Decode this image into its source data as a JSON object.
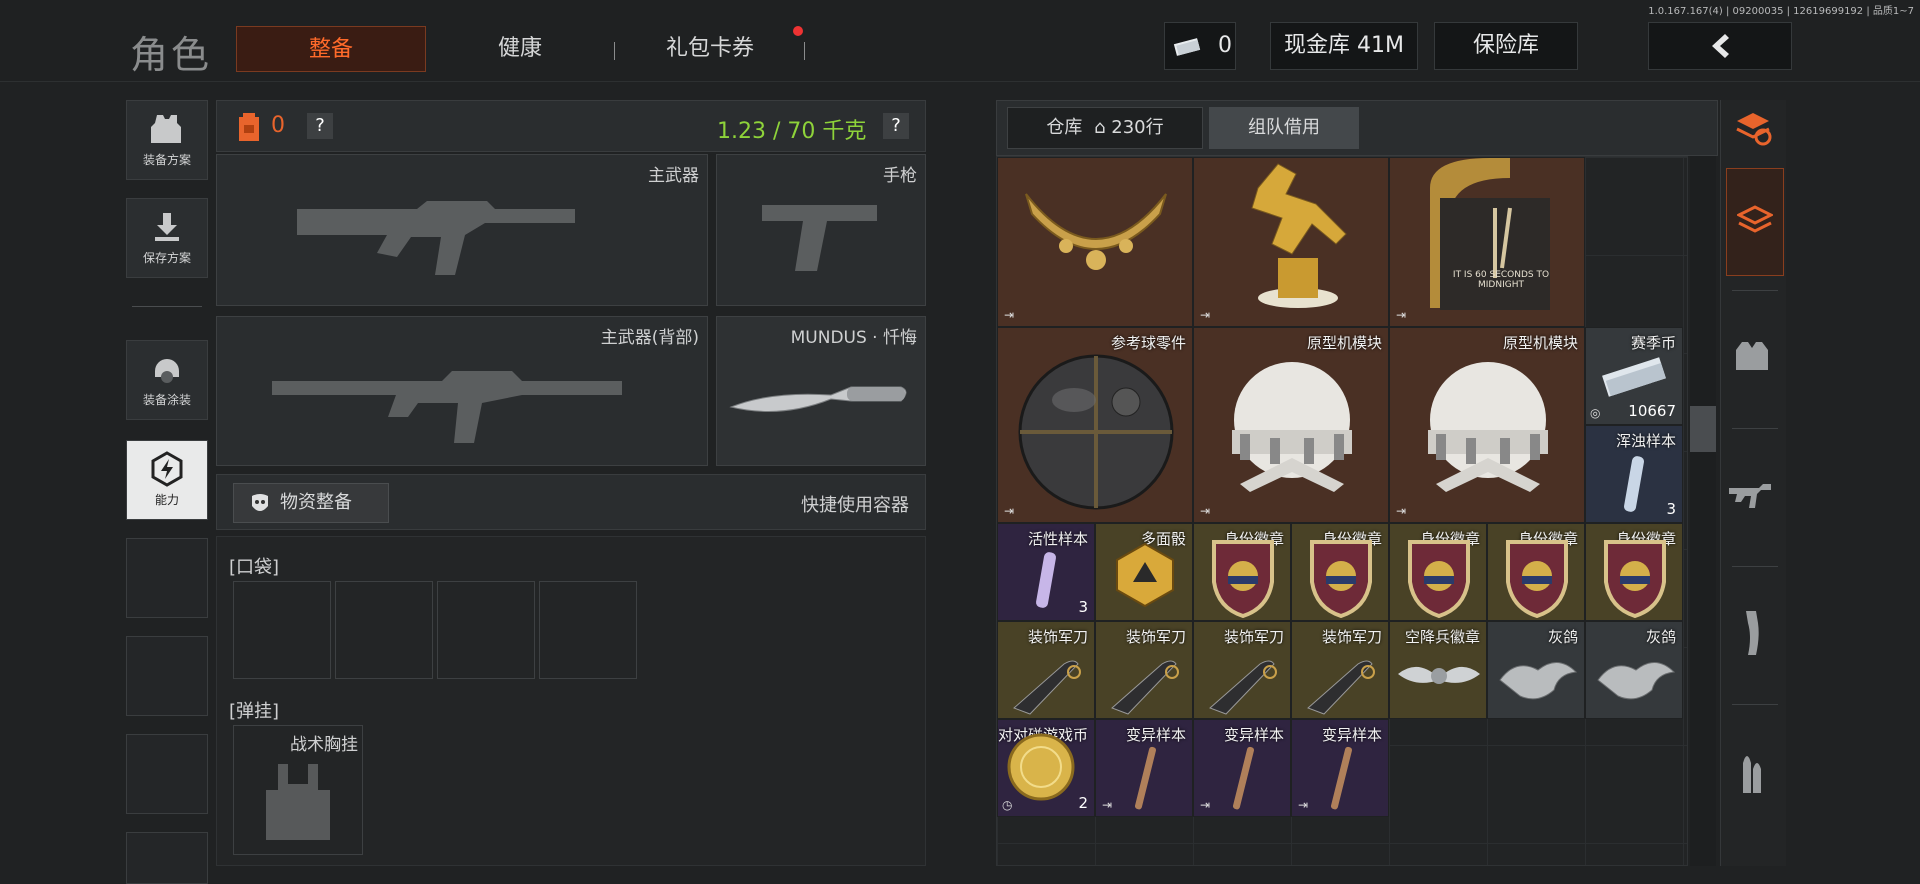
{
  "version": "1.0.167.167(4) | 09200035 | 12619699192 | 品质1~7",
  "header": {
    "title": "角色",
    "tabs": [
      {
        "label": "整备",
        "active": true
      },
      {
        "label": "健康",
        "active": false
      },
      {
        "label": "礼包卡券",
        "active": false
      }
    ],
    "cash_value": "0",
    "cash_vault": "现金库 41M",
    "safe_box": "保险库"
  },
  "left_nav": [
    {
      "label": "装备方案",
      "icon": "vest-icon"
    },
    {
      "label": "保存方案",
      "icon": "download-icon"
    },
    {
      "label": "装备涂装",
      "icon": "helmet-paint-icon"
    },
    {
      "label": "能力",
      "icon": "ability-icon",
      "selected": true
    }
  ],
  "loadout": {
    "bag_count": "0",
    "help": "?",
    "weight": "1.23 / 70 千克",
    "slots": {
      "primary": "主武器",
      "pistol": "手枪",
      "primary_back": "主武器(背部)",
      "melee": "MUNDUS · 忏悔"
    },
    "supply_button": "物资整备",
    "quick_container": "快捷使用容器",
    "pocket_label": "[口袋]",
    "rig_label": "[弹挂]",
    "rig_item": "战术胸挂"
  },
  "warehouse": {
    "tab_label": "仓库",
    "rows_text": "230行",
    "team_borrow": "组队借用",
    "items": [
      {
        "label": "",
        "color": "brown",
        "kind": "necklace",
        "mark": "⇥"
      },
      {
        "label": "",
        "color": "brown",
        "kind": "horse",
        "mark": "⇥"
      },
      {
        "label": "",
        "color": "brown",
        "kind": "clock",
        "mark": "⇥"
      },
      {
        "label": "参考球零件",
        "color": "brown",
        "kind": "sphere",
        "mark": "⇥"
      },
      {
        "label": "原型机模块",
        "color": "brown",
        "kind": "module",
        "mark": "⇥"
      },
      {
        "label": "原型机模块",
        "color": "brown",
        "kind": "module",
        "mark": "⇥"
      },
      {
        "label": "赛季币",
        "color": "gray",
        "kind": "cash",
        "count": "10667"
      },
      {
        "label": "浑浊样本",
        "color": "navy",
        "kind": "vial",
        "count": "3"
      },
      {
        "label": "活性样本",
        "color": "purple",
        "kind": "vial",
        "count": "3"
      },
      {
        "label": "多面骰",
        "color": "olive",
        "kind": "dice"
      },
      {
        "label": "身份徽章",
        "color": "olive",
        "kind": "badge"
      },
      {
        "label": "身份徽章",
        "color": "olive",
        "kind": "badge"
      },
      {
        "label": "身份徽章",
        "color": "olive",
        "kind": "badge"
      },
      {
        "label": "身份徽章",
        "color": "olive",
        "kind": "badge"
      },
      {
        "label": "身份徽章",
        "color": "olive",
        "kind": "badge"
      },
      {
        "label": "装饰军刀",
        "color": "olive",
        "kind": "knife"
      },
      {
        "label": "装饰军刀",
        "color": "olive",
        "kind": "knife"
      },
      {
        "label": "装饰军刀",
        "color": "olive",
        "kind": "knife"
      },
      {
        "label": "装饰军刀",
        "color": "olive",
        "kind": "knife"
      },
      {
        "label": "空降兵徽章",
        "color": "olive",
        "kind": "wings"
      },
      {
        "label": "灰鸽",
        "color": "gray",
        "kind": "bird"
      },
      {
        "label": "灰鸽",
        "color": "gray",
        "kind": "bird"
      },
      {
        "label": "对对碰游戏币",
        "color": "purple",
        "kind": "coin",
        "count": "2"
      },
      {
        "label": "变异样本",
        "color": "purple",
        "kind": "rod"
      },
      {
        "label": "变异样本",
        "color": "purple",
        "kind": "rod"
      },
      {
        "label": "变异样本",
        "color": "purple",
        "kind": "rod"
      }
    ],
    "clock_text": "IT IS 60 SECONDS TO MIDNIGHT"
  }
}
